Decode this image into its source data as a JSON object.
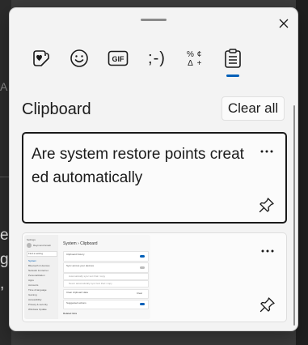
{
  "background": {
    "left_glyphs": [
      "e",
      "g",
      ","
    ],
    "left_small_glyph": "A"
  },
  "panel": {
    "close_label": "Close",
    "tabs": [
      {
        "name": "stickers",
        "icon": "heart-sticker-icon",
        "active": false
      },
      {
        "name": "emoji",
        "icon": "smiley-icon",
        "active": false
      },
      {
        "name": "gif",
        "icon": "gif-icon",
        "label": "GIF",
        "active": false
      },
      {
        "name": "kaomoji",
        "icon": "kaomoji-icon",
        "label": ";-)",
        "active": false
      },
      {
        "name": "symbols",
        "icon": "symbols-icon",
        "active": false
      },
      {
        "name": "clipboard",
        "icon": "clipboard-icon",
        "active": true
      }
    ],
    "section_title": "Clipboard",
    "clear_all_label": "Clear all",
    "items": [
      {
        "type": "text",
        "text": "Are system restore points created automatically"
      },
      {
        "type": "image",
        "description_hidden": true
      }
    ],
    "thumbnail": {
      "search_placeholder": "Find a setting",
      "breadcrumb_parent": "System",
      "breadcrumb_sep": "›",
      "breadcrumb_current": "Clipboard",
      "user_name": "Raymond Ansah",
      "nav_items": [
        "System",
        "Bluetooth & devices",
        "Network & internet",
        "Personalization",
        "Apps",
        "Accounts",
        "Time & language",
        "Gaming",
        "Accessibility",
        "Privacy & security",
        "Windows Update"
      ],
      "rows": [
        "Clipboard history",
        "Sync across your devices",
        "Automatically sync text that I copy",
        "Never automatically sync text that I copy",
        "Clear clipboard data",
        "Suggested actions"
      ],
      "clear_label": "Clear",
      "related_label": "Related links"
    }
  },
  "colors": {
    "accent": "#005fb8",
    "panel_bg": "#f3f3f3",
    "card_bg": "#fbfbfb"
  }
}
